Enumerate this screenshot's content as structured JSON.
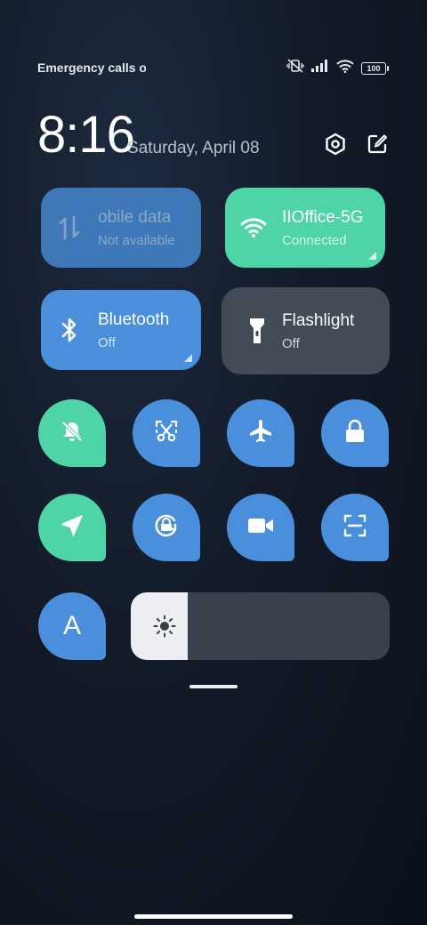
{
  "status_bar": {
    "carrier_text": "Emergency calls o",
    "battery": "100",
    "icons": [
      "mute-vibrate-icon",
      "signal-icon",
      "wifi-icon",
      "battery-icon"
    ]
  },
  "header": {
    "time": "8:16",
    "date": "Saturday, April 08",
    "icons": [
      "settings-icon",
      "edit-icon"
    ]
  },
  "tiles": {
    "mobile": {
      "title": "obile data",
      "subtitle": "Not available",
      "icon": "mobile-data-icon"
    },
    "wifi": {
      "title": "IIOffice-5G",
      "subtitle": "Connected",
      "icon": "wifi-icon"
    },
    "bluetooth": {
      "title": "Bluetooth",
      "subtitle": "Off",
      "icon": "bluetooth-icon"
    },
    "flashlight": {
      "title": "Flashlight",
      "subtitle": "Off",
      "icon": "flashlight-icon"
    }
  },
  "toggles": [
    {
      "name": "mute",
      "icon": "bell-off-icon",
      "active": true
    },
    {
      "name": "screenshot",
      "icon": "scissors-icon",
      "active": true
    },
    {
      "name": "airplane-mode",
      "icon": "airplane-icon",
      "active": true
    },
    {
      "name": "lock-screen",
      "icon": "lock-icon",
      "active": true
    },
    {
      "name": "location",
      "icon": "location-arrow-icon",
      "active": true
    },
    {
      "name": "auto-rotate",
      "icon": "rotate-lock-icon",
      "active": true
    },
    {
      "name": "screen-recorder",
      "icon": "video-camera-icon",
      "active": true
    },
    {
      "name": "scanner",
      "icon": "scan-icon",
      "active": true
    },
    {
      "name": "auto-brightness",
      "icon": "font-a-icon",
      "active": true
    }
  ],
  "font_toggle_label": "A",
  "brightness": {
    "level": 0.22,
    "icon": "sun-icon"
  },
  "colors": {
    "blue": "#4a8fdc",
    "green": "#4fd4a8",
    "dark_tile": "#434b57"
  }
}
